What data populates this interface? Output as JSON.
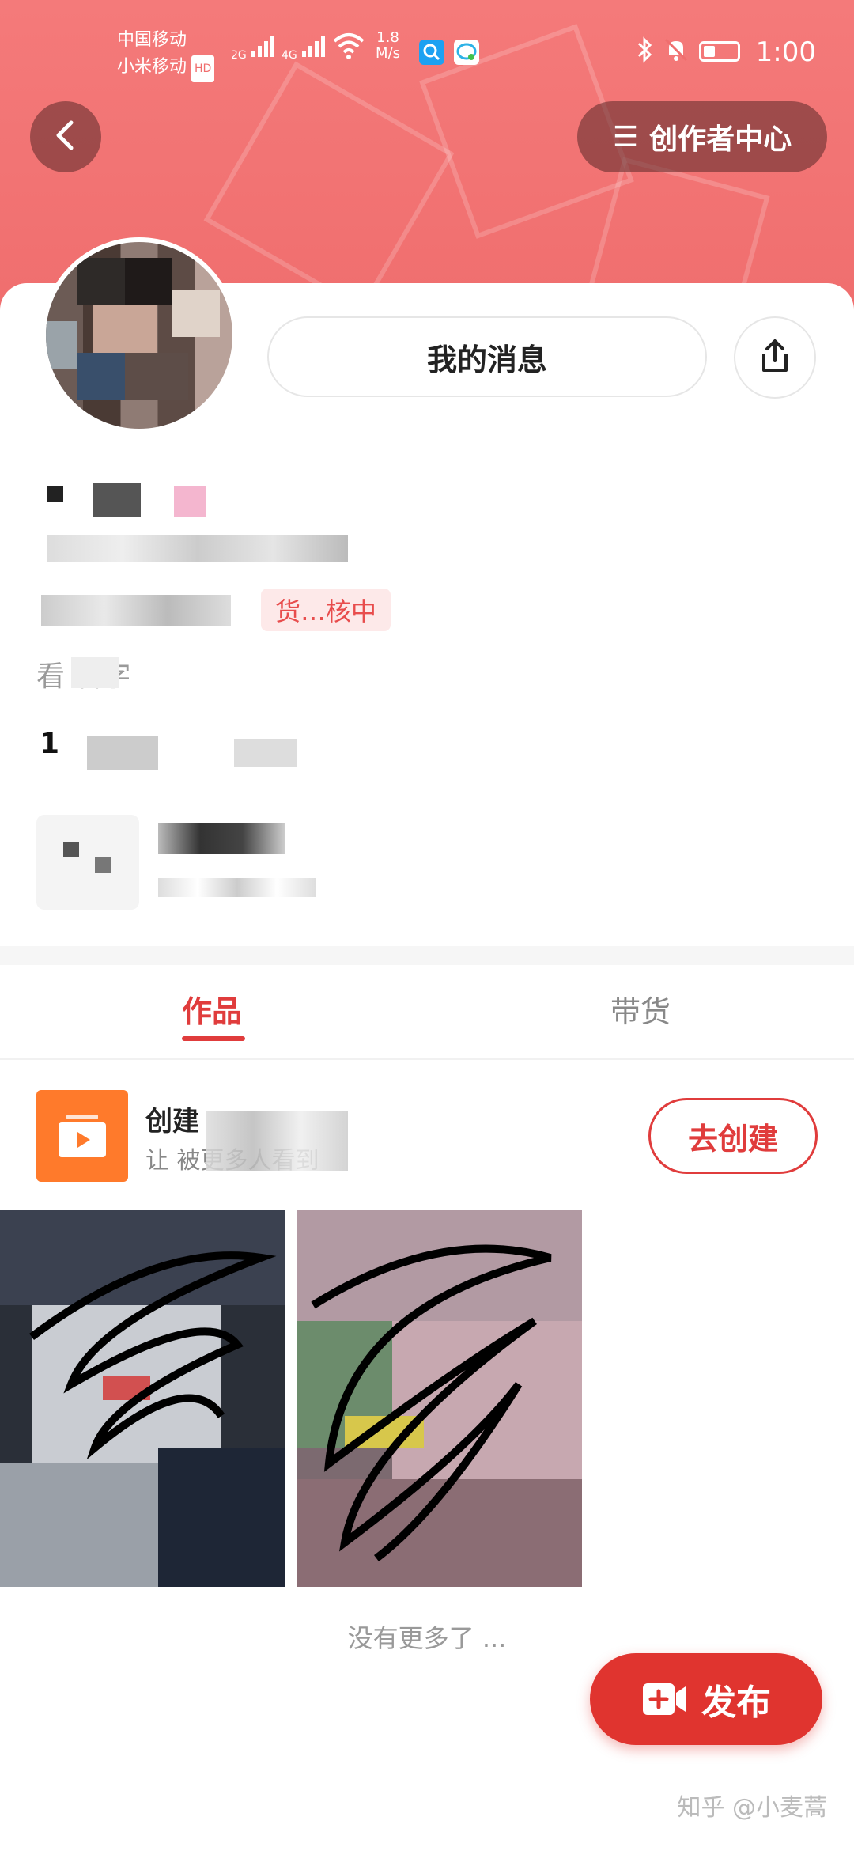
{
  "status_bar": {
    "carrier_1": "中国移动",
    "carrier_2": "小米移动",
    "hd_badge": "HD",
    "signal_1": "2G",
    "signal_2": "4G",
    "speed_value": "1.8",
    "speed_unit": "M/s",
    "time": "1:00"
  },
  "header": {
    "creator_center_label": "创作者中心"
  },
  "profile": {
    "message_button_label": "我的消息",
    "review_text": "货…核中",
    "name_fragment": "看 名字",
    "id_fragment": "1"
  },
  "tabs": [
    {
      "label": "作品",
      "active": true
    },
    {
      "label": "带货",
      "active": false
    }
  ],
  "promo": {
    "title": "创建",
    "subtitle": "让 被更多人看到",
    "button_label": "去创建"
  },
  "feed": {
    "end_text": "没有更多了 ..."
  },
  "publish": {
    "label": "发布"
  },
  "watermark": "知乎 @小麦蒿",
  "colors": {
    "accent": "#e03c3c",
    "banner": "#f06e6e",
    "promo_icon": "#ff7a2b"
  }
}
